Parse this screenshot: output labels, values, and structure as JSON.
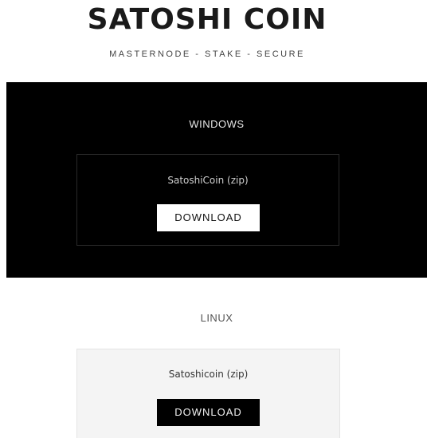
{
  "header": {
    "title": "SATOSHI COIN",
    "tagline": "MASTERNODE - STAKE - SECURE"
  },
  "sections": [
    {
      "title": "WINDOWS",
      "file_label": "SatoshiCoin (zip)",
      "button_label": "DOWNLOAD"
    },
    {
      "title": "LINUX",
      "file_label": "Satoshicoin (zip)",
      "button_label": "DOWNLOAD"
    }
  ],
  "colors": {
    "dark_section_bg": "#000000",
    "light_card_bg": "#f4f4f4",
    "title_text": "#1a1a1a"
  }
}
